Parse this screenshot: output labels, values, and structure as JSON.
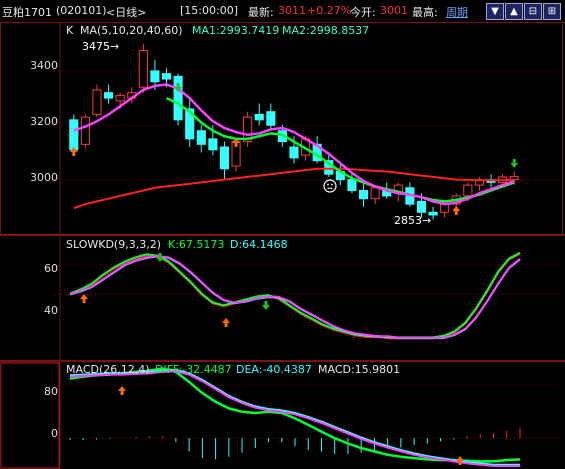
{
  "window": {
    "symbol": "豆粕1701",
    "code": "(020101)",
    "period": "<日线>",
    "time": "[15:00:00]",
    "latest_label": "最新:",
    "latest_value": "3011",
    "change": "+0.27%",
    "open_label": "今开:",
    "open_value": "3001",
    "high_label": "最高:",
    "menu_link": "周期",
    "buttons": [
      {
        "name": "down-arrow-button",
        "glyph": "▼"
      },
      {
        "name": "up-arrow-button",
        "glyph": "▲"
      },
      {
        "name": "collapse-button",
        "glyph": "⊟"
      },
      {
        "name": "expand-button",
        "glyph": "⊞"
      }
    ]
  },
  "colors": {
    "green": "#00ff30",
    "cyan": "#33ffff",
    "red": "#ff2020",
    "magenta": "#ff40ff",
    "orange": "#ff6a00",
    "white": "#ffffff",
    "grid": "#7a1010"
  },
  "price_panel": {
    "label_k": "K",
    "ma_params": "MA(5,10,20,40,60)",
    "ma1": "MA1:2993.7419",
    "ma2": "MA2:2998.8537",
    "y_ticks": [
      "3400",
      "3200",
      "3000"
    ],
    "high_marker": "3475",
    "low_marker": "2853"
  },
  "kd_panel": {
    "title": "SLOWKD(9,3,3,2)",
    "k": "K:67.5173",
    "d": "D:64.1468",
    "y_ticks": [
      "60",
      "40"
    ]
  },
  "macd_panel": {
    "title": "MACD(26,12,4)",
    "diff": "DIFF:-32.4487",
    "dea": "DEA:-40.4387",
    "macd": "MACD:15.9801",
    "y_ticks": [
      "80",
      "0"
    ]
  },
  "chart_data": [
    {
      "type": "candlestick",
      "title": "K",
      "ylim": [
        2800,
        3580
      ],
      "y_ticks": [
        3000,
        3200,
        3400
      ],
      "candles": [
        [
          3220,
          3240,
          3100,
          3110
        ],
        [
          3130,
          3240,
          3115,
          3230
        ],
        [
          3240,
          3350,
          3230,
          3330
        ],
        [
          3320,
          3350,
          3280,
          3300
        ],
        [
          3290,
          3320,
          3260,
          3310
        ],
        [
          3300,
          3340,
          3280,
          3320
        ],
        [
          3340,
          3500,
          3320,
          3475
        ],
        [
          3400,
          3440,
          3330,
          3360
        ],
        [
          3390,
          3410,
          3340,
          3370
        ],
        [
          3380,
          3390,
          3200,
          3220
        ],
        [
          3260,
          3300,
          3120,
          3150
        ],
        [
          3180,
          3200,
          3100,
          3130
        ],
        [
          3150,
          3200,
          3090,
          3110
        ],
        [
          3120,
          3140,
          3000,
          3040
        ],
        [
          3050,
          3150,
          3030,
          3140
        ],
        [
          3140,
          3250,
          3120,
          3230
        ],
        [
          3240,
          3280,
          3200,
          3220
        ],
        [
          3250,
          3280,
          3180,
          3200
        ],
        [
          3180,
          3200,
          3120,
          3140
        ],
        [
          3120,
          3160,
          3060,
          3080
        ],
        [
          3090,
          3160,
          3070,
          3150
        ],
        [
          3130,
          3160,
          3060,
          3070
        ],
        [
          3070,
          3090,
          3010,
          3020
        ],
        [
          3030,
          3060,
          2980,
          3000
        ],
        [
          3000,
          3030,
          2950,
          2960
        ],
        [
          2960,
          2990,
          2900,
          2930
        ],
        [
          2930,
          2980,
          2910,
          2970
        ],
        [
          2960,
          2990,
          2930,
          2940
        ],
        [
          2950,
          2990,
          2920,
          2980
        ],
        [
          2970,
          2990,
          2900,
          2910
        ],
        [
          2920,
          2950,
          2860,
          2880
        ],
        [
          2880,
          2900,
          2853,
          2870
        ],
        [
          2880,
          2920,
          2860,
          2910
        ],
        [
          2910,
          2950,
          2890,
          2940
        ],
        [
          2940,
          2990,
          2920,
          2980
        ],
        [
          2980,
          3010,
          2960,
          3000
        ],
        [
          3000,
          3020,
          2970,
          2990
        ],
        [
          2990,
          3020,
          2970,
          3010
        ],
        [
          3000,
          3030,
          2980,
          3011
        ]
      ],
      "ma1": [
        3180,
        3195,
        3215,
        3240,
        3270,
        3300,
        3330,
        3345,
        3350,
        3335,
        3300,
        3255,
        3215,
        3190,
        3175,
        3165,
        3170,
        3185,
        3190,
        3175,
        3150,
        3125,
        3095,
        3060,
        3025,
        2995,
        2975,
        2960,
        2950,
        2945,
        2935,
        2920,
        2910,
        2915,
        2930,
        2950,
        2965,
        2980,
        2994
      ],
      "ma2": [
        2895,
        2910,
        2920,
        2930,
        2940,
        2950,
        2960,
        2970,
        2975,
        2980,
        2985,
        2990,
        2995,
        3000,
        3005,
        3010,
        3015,
        3020,
        3025,
        3030,
        3035,
        3040,
        3040,
        3040,
        3038,
        3035,
        3032,
        3030,
        3025,
        3020,
        3015,
        3010,
        3005,
        3000,
        2999,
        2998,
        2998,
        2998,
        2999
      ],
      "ma_green": [
        null,
        null,
        null,
        null,
        null,
        null,
        null,
        null,
        3300,
        3280,
        3250,
        3210,
        3180,
        3160,
        3150,
        3150,
        3160,
        3170,
        3165,
        3140,
        3115,
        3090,
        3060,
        3030,
        3005,
        2990,
        2975,
        2965,
        2955,
        2945,
        2935,
        2925,
        2920,
        2925,
        2935,
        2945,
        2960,
        2975,
        2990
      ]
    },
    {
      "type": "line",
      "title": "SLOWKD(9,3,3,2)",
      "ylim": [
        -5,
        80
      ],
      "y_ticks": [
        40,
        60
      ],
      "series": [
        {
          "name": "K",
          "values": [
            40,
            43,
            47,
            53,
            58,
            62,
            65,
            67,
            66,
            62,
            55,
            48,
            40,
            34,
            32,
            34,
            36,
            38,
            39,
            37,
            32,
            27,
            23,
            19,
            16,
            14,
            12,
            11,
            11,
            10,
            10,
            10,
            10,
            10,
            11,
            14,
            20,
            30,
            42,
            55,
            64,
            68
          ]
        },
        {
          "name": "D",
          "values": [
            40,
            42,
            45,
            50,
            55,
            60,
            63,
            65,
            66,
            65,
            61,
            55,
            48,
            41,
            36,
            34,
            35,
            37,
            38,
            38,
            35,
            30,
            26,
            22,
            18,
            15,
            13,
            12,
            11,
            11,
            10,
            10,
            10,
            10,
            10,
            12,
            16,
            24,
            35,
            47,
            58,
            64
          ]
        }
      ]
    },
    {
      "type": "line",
      "title": "MACD(26,12,4)",
      "ylim": [
        -45,
        115
      ],
      "y_ticks": [
        0,
        80
      ],
      "series": [
        {
          "name": "DIFF",
          "values": [
            90,
            93,
            95,
            96,
            98,
            100,
            102,
            105,
            100,
            85,
            68,
            55,
            45,
            40,
            38,
            40,
            38,
            30,
            20,
            10,
            0,
            -8,
            -15,
            -20,
            -25,
            -28,
            -30,
            -32,
            -33,
            -33,
            -34,
            -35,
            -35,
            -33,
            -32
          ]
        },
        {
          "name": "DEA",
          "values": [
            95,
            96,
            97,
            98,
            98,
            99,
            100,
            102,
            103,
            98,
            88,
            76,
            64,
            55,
            48,
            44,
            42,
            38,
            32,
            25,
            17,
            9,
            1,
            -6,
            -12,
            -18,
            -23,
            -27,
            -30,
            -33,
            -36,
            -38,
            -40,
            -40,
            -40
          ]
        },
        {
          "name": "MACD",
          "values": [
            -3,
            -3,
            -2,
            -1,
            0,
            2,
            3,
            4,
            -6,
            -20,
            -30,
            -32,
            -28,
            -22,
            -15,
            -6,
            -6,
            -12,
            -18,
            -20,
            -24,
            -24,
            -22,
            -18,
            -16,
            -14,
            -10,
            -8,
            -5,
            -2,
            3,
            6,
            8,
            12,
            16
          ]
        }
      ]
    }
  ]
}
